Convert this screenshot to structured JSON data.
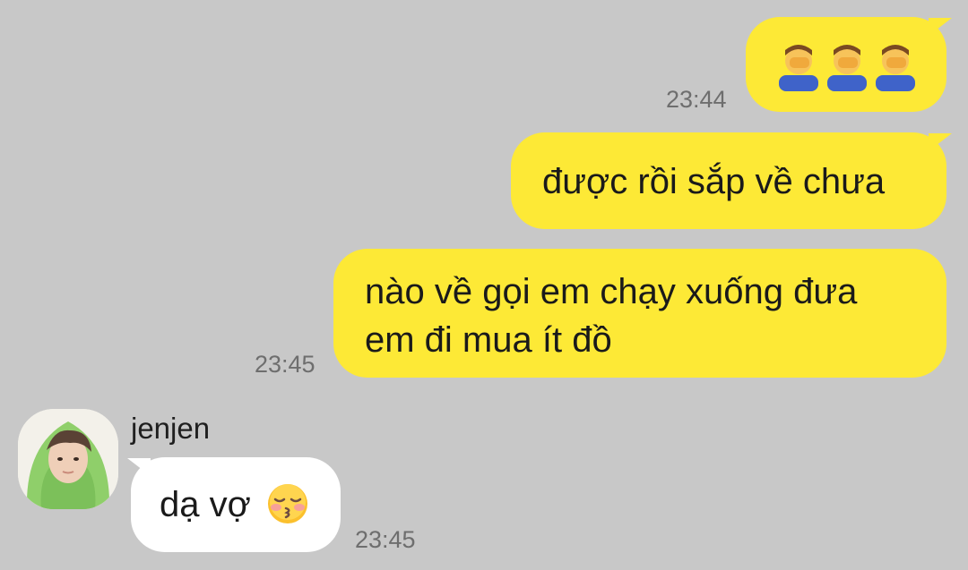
{
  "conversation": {
    "messages": [
      {
        "direction": "sent",
        "content": "facepalm-emoji x3",
        "emoji": [
          "person-facepalming-emoji",
          "person-facepalming-emoji",
          "person-facepalming-emoji"
        ],
        "time": "23:44"
      },
      {
        "direction": "sent",
        "text": "được rồi sắp về chưa"
      },
      {
        "direction": "sent",
        "text_line1": "nào về gọi em chạy xuống đưa",
        "text_line2": "em đi mua ít đồ",
        "time": "23:45"
      },
      {
        "direction": "received",
        "sender": "jenjen",
        "text": "dạ vợ",
        "emoji": "kissing-face-with-closed-eyes-emoji",
        "time": "23:45"
      }
    ]
  },
  "colors": {
    "background": "#c8c8c8",
    "sent_bubble": "#fde936",
    "received_bubble": "#ffffff",
    "timestamp": "#6e6e6e",
    "avatar_hoodie": "#8fcf6a"
  }
}
